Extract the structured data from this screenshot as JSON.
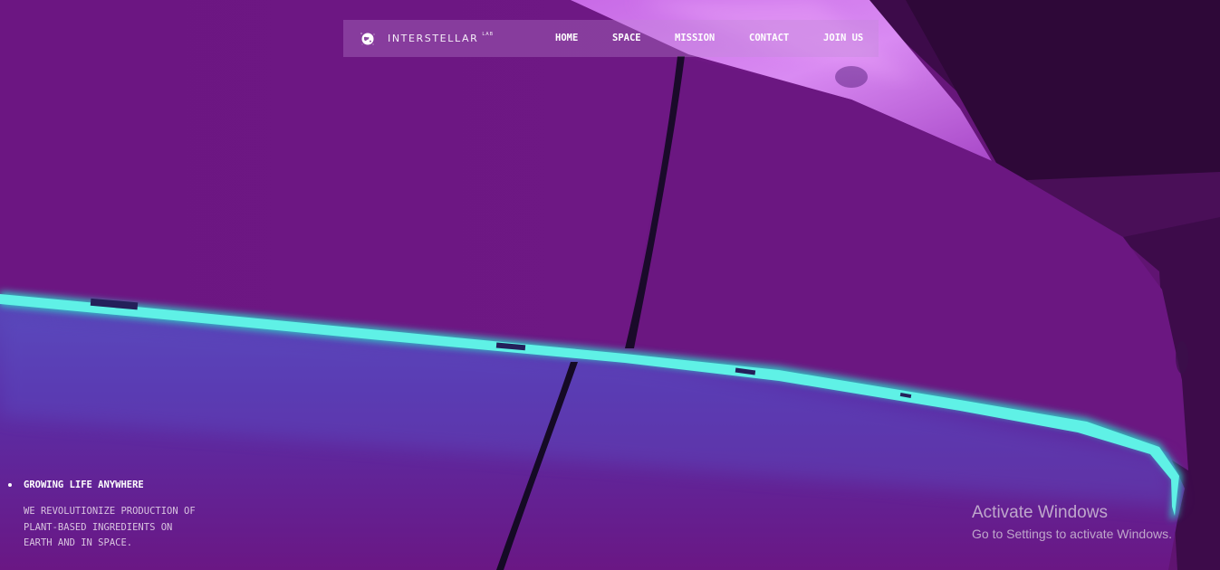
{
  "navbar": {
    "brand": {
      "name": "INTERSTELLAR",
      "superscript": "LAB",
      "icon": "globe-icon"
    },
    "links": [
      {
        "id": "home",
        "label": "HOME"
      },
      {
        "id": "space",
        "label": "SPACE"
      },
      {
        "id": "mission",
        "label": "MISSION"
      },
      {
        "id": "contact",
        "label": "CONTACT"
      },
      {
        "id": "join",
        "label": "JOIN US"
      }
    ]
  },
  "hero": {
    "tagline": "GROWING LIFE ANYWHERE",
    "description_lines": [
      "WE REVOLUTIONIZE PRODUCTION OF",
      "PLANT-BASED INGREDIENTS ON",
      "EARTH AND IN SPACE."
    ]
  },
  "watermark": {
    "title": "Activate Windows",
    "subtitle": "Go to Settings to activate Windows."
  },
  "colors": {
    "background_purple": "#6a157e",
    "glow_cyan": "#3fe6d6",
    "highlight_pink": "#d677f0"
  }
}
